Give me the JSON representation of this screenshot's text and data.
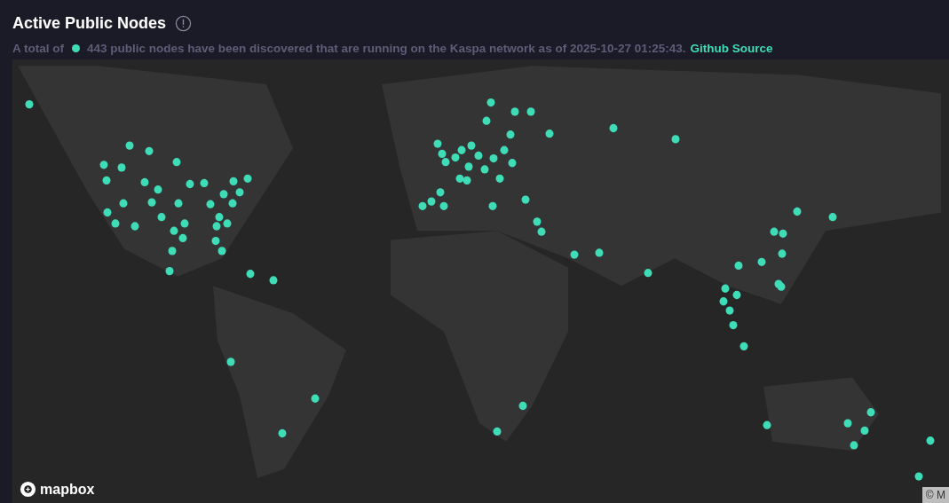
{
  "header": {
    "title": "Active Public Nodes",
    "subtitle_prefix": "A total of",
    "subtitle": "443 public nodes have been discovered that are running on the Kaspa network as of 2025-10-27 01:25:43.",
    "source_link": "Github Source"
  },
  "map": {
    "logo": "mapbox",
    "attribution": "© M"
  }
}
